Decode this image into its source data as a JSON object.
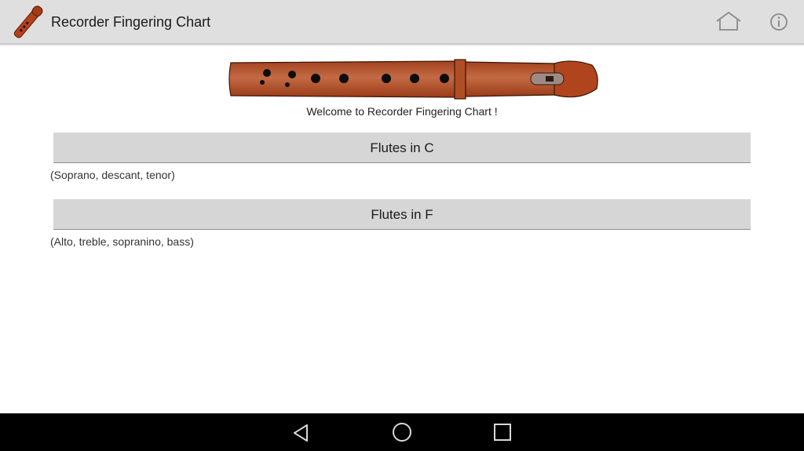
{
  "app": {
    "title": "Recorder Fingering Chart",
    "logo_icon": "recorder-logo-icon",
    "accent_color": "#b5411a"
  },
  "toolbar": {
    "home_icon": "home-icon",
    "info_icon": "info-icon"
  },
  "content": {
    "hero_image": "recorder-illustration",
    "welcome_text": "Welcome to Recorder Fingering Chart !",
    "groups": [
      {
        "label": "Flutes in C",
        "subtitle": "(Soprano, descant, tenor)"
      },
      {
        "label": "Flutes in F",
        "subtitle": "(Alto, treble, sopranino, bass)"
      }
    ]
  },
  "navigation": {
    "back_icon": "back-triangle-icon",
    "home_icon": "home-circle-icon",
    "recents_icon": "recents-square-icon"
  }
}
